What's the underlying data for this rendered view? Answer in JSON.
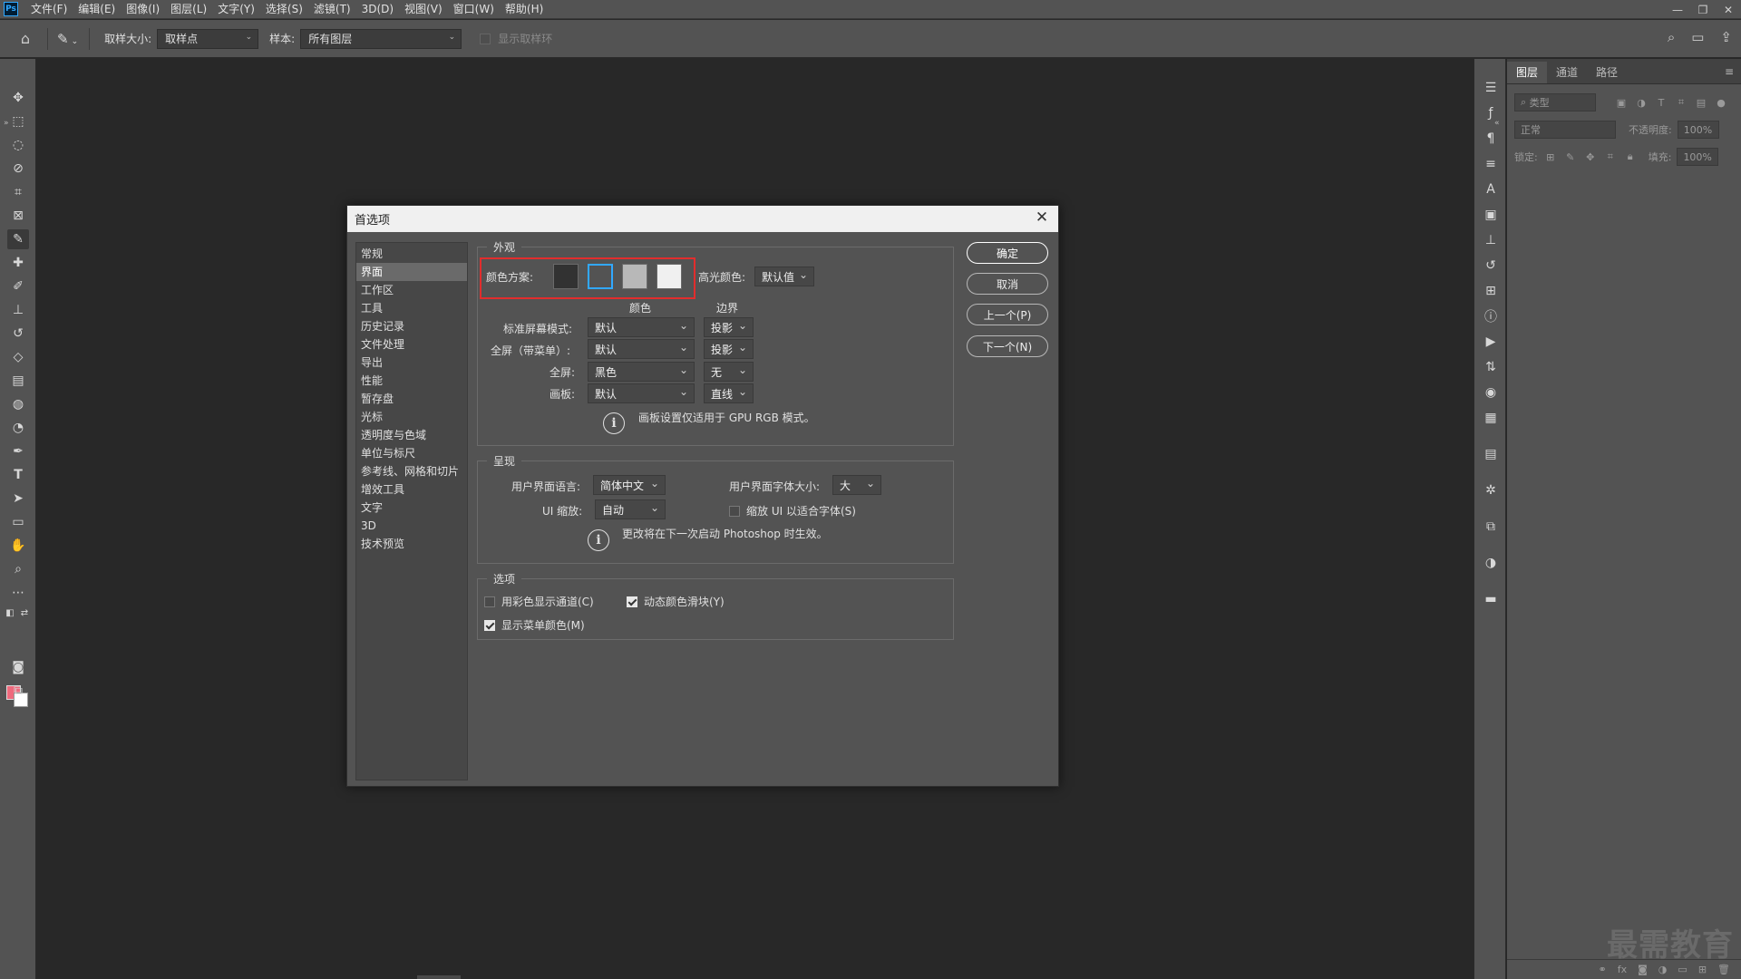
{
  "app": {
    "logo": "Ps"
  },
  "menu": [
    "文件(F)",
    "编辑(E)",
    "图像(I)",
    "图层(L)",
    "文字(Y)",
    "选择(S)",
    "滤镜(T)",
    "3D(D)",
    "视图(V)",
    "窗口(W)",
    "帮助(H)"
  ],
  "options_bar": {
    "sample_size_label": "取样大小:",
    "sample_size_value": "取样点",
    "sample_label": "样本:",
    "sample_value": "所有图层",
    "show_ring_label": "显示取样环"
  },
  "layers_panel": {
    "tabs": [
      "图层",
      "通道",
      "路径"
    ],
    "kind_placeholder": "类型",
    "blend_mode": "正常",
    "opacity_label": "不透明度:",
    "opacity_value": "100%",
    "lock_label": "锁定:",
    "fill_label": "填充:",
    "fill_value": "100%"
  },
  "dialog": {
    "title": "首选项",
    "nav": [
      "常规",
      "界面",
      "工作区",
      "工具",
      "历史记录",
      "文件处理",
      "导出",
      "性能",
      "暂存盘",
      "光标",
      "透明度与色域",
      "单位与标尺",
      "参考线、网格和切片",
      "增效工具",
      "文字",
      "3D",
      "技术预览"
    ],
    "nav_active_index": 1,
    "appearance": {
      "title": "外观",
      "color_scheme_label": "颜色方案:",
      "swatch_colors": [
        "#323232",
        "#535353",
        "#b8b8b8",
        "#f0f0f0"
      ],
      "selected_swatch_index": 1,
      "highlight_label": "高光颜色:",
      "highlight_value": "默认值",
      "col_color": "颜色",
      "col_border": "边界",
      "rows": [
        {
          "label": "标准屏幕模式:",
          "color": "默认",
          "border": "投影"
        },
        {
          "label": "全屏（带菜单）:",
          "color": "默认",
          "border": "投影"
        },
        {
          "label": "全屏:",
          "color": "黑色",
          "border": "无"
        },
        {
          "label": "画板:",
          "color": "默认",
          "border": "直线"
        }
      ],
      "note": "画板设置仅适用于 GPU RGB 模式。"
    },
    "presentation": {
      "title": "呈现",
      "ui_language_label": "用户界面语言:",
      "ui_language_value": "简体中文",
      "ui_font_size_label": "用户界面字体大小:",
      "ui_font_size_value": "大",
      "ui_scale_label": "UI 缩放:",
      "ui_scale_value": "自动",
      "scale_to_font_label": "缩放 UI 以适合字体(S)",
      "scale_to_font_checked": false,
      "note": "更改将在下一次启动 Photoshop 时生效。"
    },
    "options": {
      "title": "选项",
      "color_channels_label": "用彩色显示通道(C)",
      "color_channels_checked": false,
      "dynamic_sliders_label": "动态颜色滑块(Y)",
      "dynamic_sliders_checked": true,
      "menu_colors_label": "显示菜单颜色(M)",
      "menu_colors_checked": true
    },
    "buttons": {
      "ok": "确定",
      "cancel": "取消",
      "prev": "上一个(P)",
      "next": "下一个(N)"
    }
  },
  "colors": {
    "foreground": "#ef6a7d",
    "background": "#ffffff",
    "highlight_border": "#e22d2d"
  },
  "watermark": "最需教育"
}
